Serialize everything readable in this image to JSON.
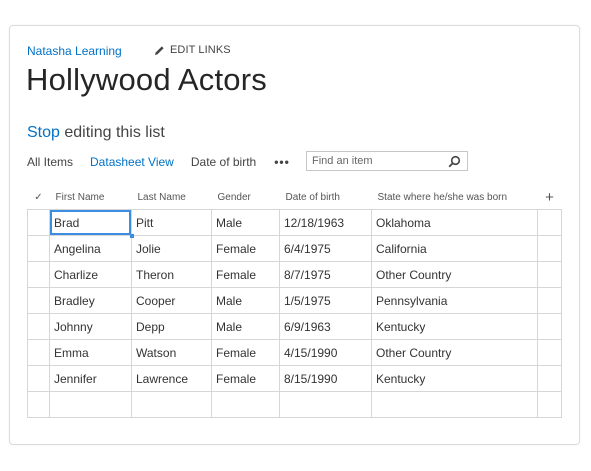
{
  "breadcrumb": {
    "site": "Natasha Learning",
    "edit_links": "EDIT LINKS"
  },
  "page": {
    "title": "Hollywood Actors"
  },
  "editing": {
    "stop": "Stop",
    "rest": " editing this list"
  },
  "views": {
    "items": [
      "All Items",
      "Datasheet View",
      "Date of birth"
    ],
    "active_index": 1,
    "more": "•••"
  },
  "search": {
    "placeholder": "Find an item"
  },
  "table": {
    "select_glyph": "✓",
    "add_column_glyph": "+",
    "columns": [
      "First Name",
      "Last Name",
      "Gender",
      "Date of birth",
      "State where he/she was born"
    ],
    "rows": [
      [
        "Brad",
        "Pitt",
        "Male",
        "12/18/1963",
        "Oklahoma"
      ],
      [
        "Angelina",
        "Jolie",
        "Female",
        "6/4/1975",
        "California"
      ],
      [
        "Charlize",
        "Theron",
        "Female",
        "8/7/1975",
        "Other Country"
      ],
      [
        "Bradley",
        "Cooper",
        "Male",
        "1/5/1975",
        "Pennsylvania"
      ],
      [
        "Johnny",
        "Depp",
        "Male",
        "6/9/1963",
        "Kentucky"
      ],
      [
        "Emma",
        "Watson",
        "Female",
        "4/15/1990",
        "Other Country"
      ],
      [
        "Jennifer",
        "Lawrence",
        "Female",
        "8/15/1990",
        "Kentucky"
      ],
      [
        "",
        "",
        "",
        "",
        ""
      ]
    ],
    "active_cell": "Brad"
  },
  "colors": {
    "link": "#0072c6",
    "text": "#333333",
    "grid_border": "#d6d6d6",
    "active_cell": "#3a8de0"
  }
}
